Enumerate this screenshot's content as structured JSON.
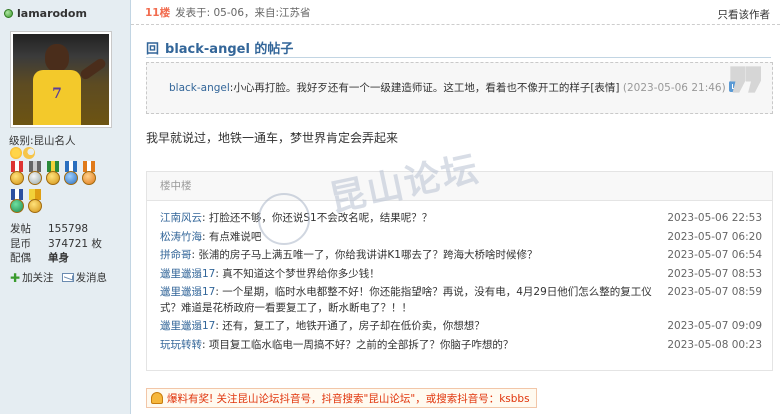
{
  "user": {
    "name": "lamarodom",
    "level_label": "级别:",
    "level_value": "昆山名人",
    "stats": [
      {
        "label": "发帖",
        "value": "155798"
      },
      {
        "label": "昆币",
        "value": "374721 枚"
      },
      {
        "label": "配偶",
        "value": "单身"
      }
    ],
    "follow_label": "加关注",
    "message_label": "发消息"
  },
  "post": {
    "floor": "11楼",
    "info": "发表于: 05-06，来自:江苏省",
    "only_author": "只看该作者"
  },
  "quote": {
    "title_prefix": "回",
    "title": "black-angel 的帖子",
    "author": "black-angel",
    "text": ":小心再打脸。我好歹还有一个一级建造师证。这工地，看着也不像开工的样子[表情]",
    "time": "(2023-05-06 21:46)"
  },
  "main_text": "我早就说过，地铁一通车，梦世界肯定会弄起来",
  "lzl": {
    "header": "楼中楼",
    "rows": [
      {
        "author": "江南风云",
        "text": ": 打脸还不够，你还说S1不会改名呢，结果呢？？",
        "time": "2023-05-06 22:53"
      },
      {
        "author": "松涛竹海",
        "text": ": 有点难说吧",
        "time": "2023-05-07 06:20"
      },
      {
        "author": "拼命哥",
        "text": ": 张浦的房子马上满五唯一了，你给我讲讲K1哪去了？跨海大桥啥时候修？",
        "time": "2023-05-07 06:54"
      },
      {
        "author": "邋里邋遢17",
        "text": ": 真不知道这个梦世界给你多少钱！",
        "time": "2023-05-07 08:53"
      },
      {
        "author": "邋里邋遢17",
        "text": ": 一个星期，临时水电都整不好！你还能指望啥？再说，没有电，4月29日他们怎么整的复工仪式？难道是花桥政府一看要复工了，断水断电了？！！",
        "time": "2023-05-07 08:59"
      },
      {
        "author": "邋里邋遢17",
        "text": ": 还有，复工了，地铁开通了，房子却在低价卖，你想想？",
        "time": "2023-05-07 09:09"
      },
      {
        "author": "玩玩转转",
        "text": ": 项目复工临水临电一周搞不好？之前的全部拆了？你脑子咋想的？",
        "time": "2023-05-08 00:23"
      }
    ]
  },
  "watermark": "昆山论坛",
  "banner": "爆料有奖! 关注昆山论坛抖音号，抖音搜索\"昆山论坛\"，或搜索抖音号：ksbbs"
}
